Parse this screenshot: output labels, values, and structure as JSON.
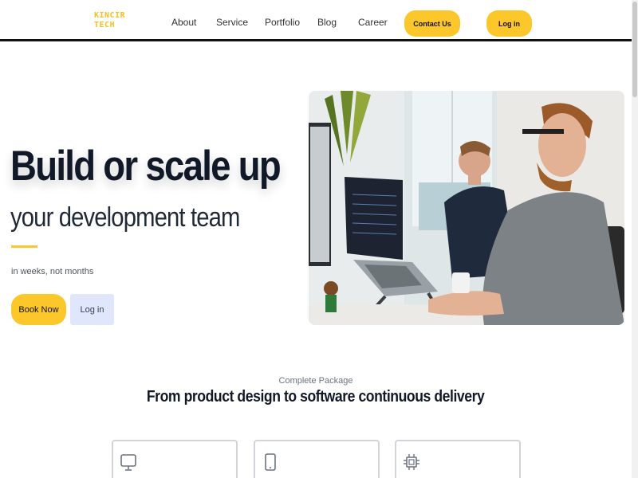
{
  "header": {
    "logo_line1": "KINCIR",
    "logo_line2": "TECH",
    "nav": {
      "about": "About",
      "service": "Service",
      "portfolio": "Portfolio",
      "blog": "Blog",
      "career": "Career"
    },
    "contact_label": "Contact Us",
    "login_label": "Log in"
  },
  "hero": {
    "title": "Build or scale up",
    "subtitle": "your development team",
    "tagline": "in weeks, not months",
    "book_label": "Book Now",
    "login_label": "Log in"
  },
  "section": {
    "kicker": "Complete Package",
    "title": "From product design to software continuous delivery"
  },
  "cards": [
    {
      "icon": "monitor-icon"
    },
    {
      "icon": "smartphone-icon"
    },
    {
      "icon": "cpu-icon"
    }
  ],
  "colors": {
    "accent": "#fcc72b",
    "secondary_button": "#e0e6fb",
    "text_dark": "#111827"
  }
}
